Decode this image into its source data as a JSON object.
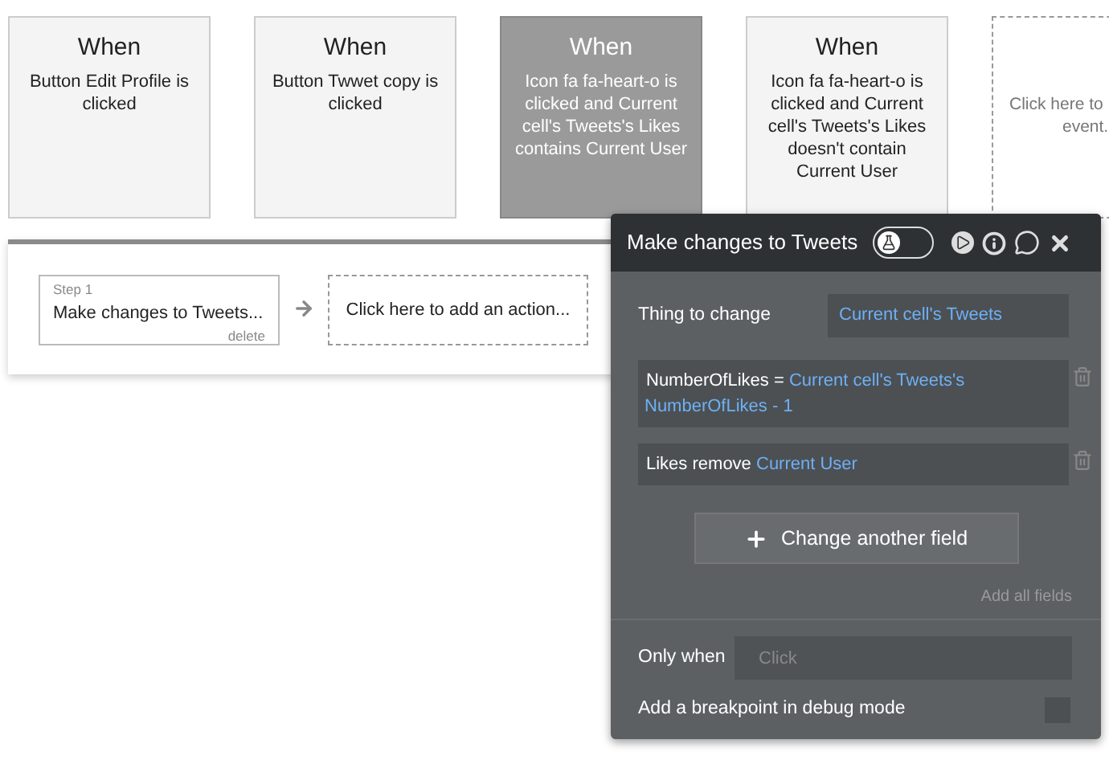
{
  "events": [
    {
      "heading": "When",
      "description": "Button Edit Profile is clicked",
      "selected": false
    },
    {
      "heading": "When",
      "description": "Button Twwet copy is clicked",
      "selected": false
    },
    {
      "heading": "When",
      "description": "Icon fa fa-heart-o is clicked and Current cell's Tweets's Likes contains Current User",
      "selected": true
    },
    {
      "heading": "When",
      "description": "Icon fa fa-heart-o is clicked and Current cell's Tweets's Likes doesn't contain Current User",
      "selected": false
    }
  ],
  "add_event": {
    "lines": [
      "Click here to",
      "event."
    ]
  },
  "actions": [
    {
      "step": "Step 1",
      "title": "Make changes to Tweets...",
      "delete": "delete"
    }
  ],
  "add_action": "Click here to add an action...",
  "panel": {
    "title": "Make changes to Tweets",
    "debug_toggle": {
      "on": false
    },
    "thing_label": "Thing to change",
    "thing_value": "Current cell's Tweets",
    "fields": [
      {
        "name": "NumberOfLikes",
        "operator": "=",
        "value": "Current cell's Tweets's NumberOfLikes - 1"
      },
      {
        "name": "Likes",
        "operator": "remove",
        "value": "Current User"
      }
    ],
    "change_button": "Change another field",
    "add_all": "Add all fields",
    "only_when_label": "Only when",
    "only_when_placeholder": "Click",
    "breakpoint_label": "Add a breakpoint in debug mode",
    "breakpoint": {
      "checked": false
    }
  }
}
